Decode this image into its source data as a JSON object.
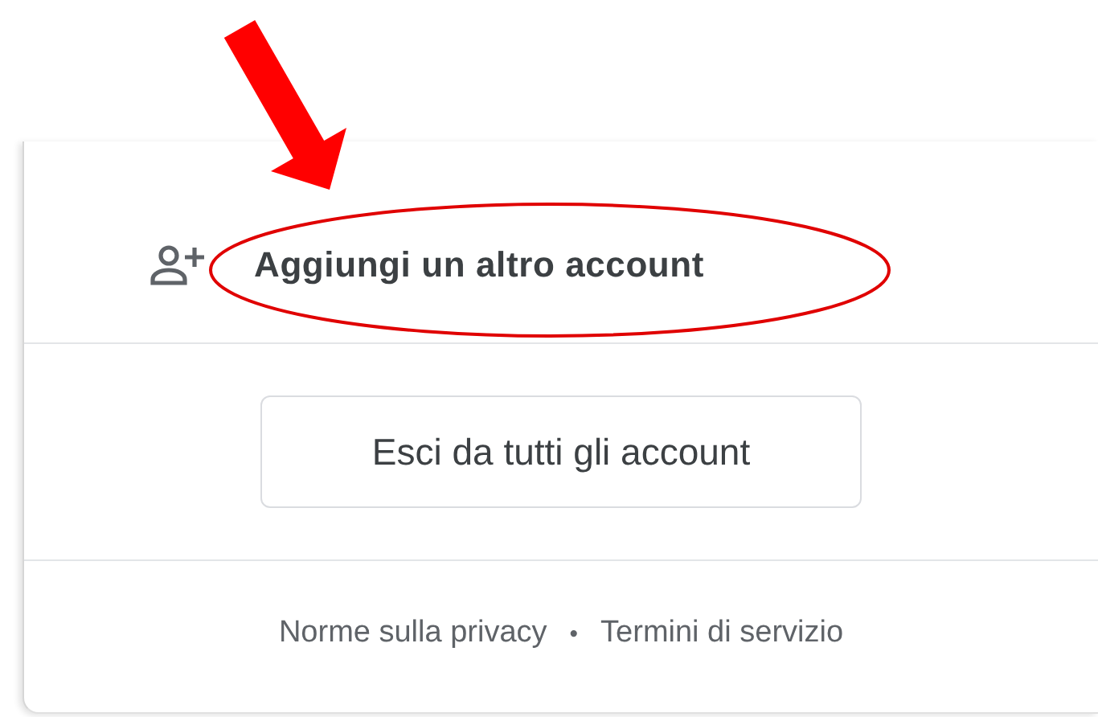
{
  "menu": {
    "add_account": {
      "label": "Aggiungi un altro account"
    },
    "sign_out_button": {
      "label": "Esci da tutti gli account"
    },
    "footer_links": [
      {
        "label": "Norme sulla privacy"
      },
      {
        "label": "Termini di servizio"
      }
    ],
    "footer_separator": "•"
  },
  "annotations": {
    "arrow": true,
    "ellipse": true
  }
}
